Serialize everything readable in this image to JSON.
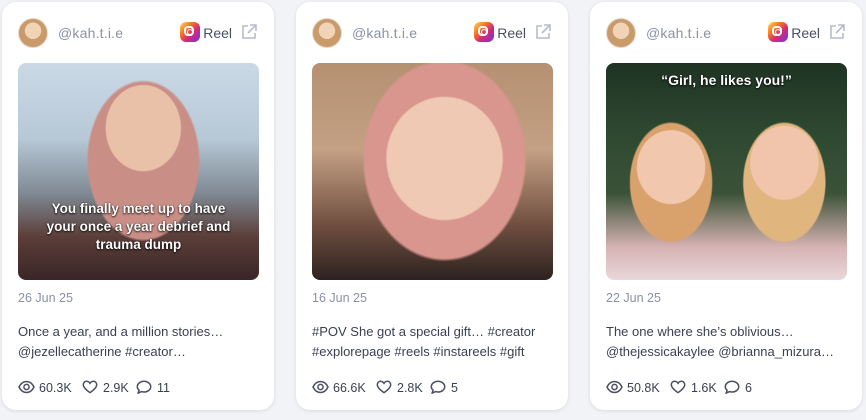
{
  "cards": [
    {
      "handle": "@kah.t.i.e",
      "platform_label": "Reel",
      "overlay_text": "You finally meet up to have your once a year debrief and trauma dump",
      "date": "26 Jun 25",
      "caption_line1": "Once a year, and a million stories…",
      "caption_line2": "@jezellecatherine #creator…",
      "views": "60.3K",
      "likes": "2.9K",
      "comments": "11"
    },
    {
      "handle": "@kah.t.i.e",
      "platform_label": "Reel",
      "overlay_text": "",
      "date": "16 Jun 25",
      "caption_line1": "#POV She got a special gift… #creator",
      "caption_line2": "#explorepage #reels #instareels #gift",
      "views": "66.6K",
      "likes": "2.8K",
      "comments": "5"
    },
    {
      "handle": "@kah.t.i.e",
      "platform_label": "Reel",
      "overlay_text": "“Girl, he likes you!”",
      "date": "22 Jun 25",
      "caption_line1": "The one where she’s oblivious…",
      "caption_line2": "@thejessicakaylee @brianna_mizura…",
      "views": "50.8K",
      "likes": "1.6K",
      "comments": "6"
    }
  ],
  "icons": {
    "platform": "instagram-icon",
    "external": "external-link-icon",
    "views": "eye-icon",
    "likes": "heart-icon",
    "comments": "comment-icon"
  },
  "colors": {
    "card_bg": "#ffffff",
    "page_bg": "#f2f3f7",
    "muted_text": "#8a90a6",
    "body_text": "#3a3f52"
  }
}
